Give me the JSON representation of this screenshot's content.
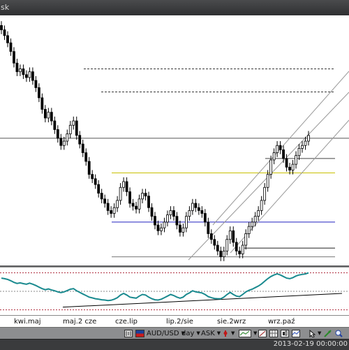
{
  "window": {
    "title": "sk"
  },
  "x_axis": {
    "labels": [
      {
        "id": "kwi",
        "text": "kwi.maj"
      },
      {
        "id": "maj",
        "text": "maj.2 cze"
      },
      {
        "id": "cze",
        "text": "cze.lip"
      },
      {
        "id": "lip",
        "text": "lip.2/sie"
      },
      {
        "id": "sie",
        "text": "sie.2wrz"
      },
      {
        "id": "wrz",
        "text": "wrz.paź"
      }
    ]
  },
  "toolbar": {
    "symbol": "AUD/USD",
    "period": "day",
    "price_side": "ASK"
  },
  "status": {
    "timestamp": "2013-02-19 00:00:00"
  },
  "colors": {
    "bull": "#ffffff",
    "bear": "#000000",
    "indicator": "#1a8a8f",
    "hline_blue": "#2020c0",
    "hline_yellow": "#c8c000",
    "band_red": "#b03040",
    "channel": "#999999"
  },
  "icons": [
    "chart-mode-icon",
    "dropdown-icon",
    "arrow-tool-icon",
    "period-tool-icon",
    "pointer-icon",
    "zoom-icon",
    "settings-icon"
  ],
  "chart_data": {
    "type": "candlestick",
    "instrument": "AUD/USD",
    "period": "day",
    "closes": [
      1.075,
      1.071,
      1.066,
      1.06,
      1.052,
      1.046,
      1.048,
      1.044,
      1.042,
      1.046,
      1.04,
      1.035,
      1.028,
      1.02,
      1.014,
      1.018,
      1.012,
      1.006,
      1.0,
      0.995,
      0.998,
      1.003,
      1.009,
      1.012,
      1.002,
      0.996,
      0.99,
      0.984,
      0.975,
      0.972,
      0.968,
      0.962,
      0.958,
      0.955,
      0.95,
      0.948,
      0.952,
      0.957,
      0.966,
      0.97,
      0.963,
      0.955,
      0.953,
      0.951,
      0.958,
      0.962,
      0.96,
      0.952,
      0.946,
      0.94,
      0.936,
      0.938,
      0.942,
      0.947,
      0.95,
      0.946,
      0.94,
      0.935,
      0.938,
      0.946,
      0.95,
      0.955,
      0.952,
      0.95,
      0.948,
      0.942,
      0.934,
      0.93,
      0.926,
      0.922,
      0.918,
      0.922,
      0.93,
      0.936,
      0.928,
      0.922,
      0.92,
      0.926,
      0.934,
      0.939,
      0.942,
      0.946,
      0.95,
      0.957,
      0.966,
      0.975,
      0.985,
      0.99,
      0.995,
      0.992,
      0.986,
      0.98,
      0.978,
      0.982,
      0.988,
      0.993,
      0.995,
      0.998,
      1.002
    ],
    "indicator": [
      0.5,
      0.48,
      0.45,
      0.4,
      0.34,
      0.3,
      0.32,
      0.29,
      0.27,
      0.31,
      0.27,
      0.22,
      0.16,
      0.1,
      0.06,
      0.09,
      0.05,
      0.02,
      -0.02,
      -0.05,
      -0.02,
      0.03,
      0.08,
      0.1,
      0.02,
      -0.04,
      -0.1,
      -0.16,
      -0.22,
      -0.25,
      -0.28,
      -0.3,
      -0.32,
      -0.33,
      -0.35,
      -0.34,
      -0.3,
      -0.24,
      -0.14,
      -0.08,
      -0.14,
      -0.22,
      -0.24,
      -0.26,
      -0.18,
      -0.12,
      -0.14,
      -0.22,
      -0.28,
      -0.32,
      -0.33,
      -0.3,
      -0.24,
      -0.18,
      -0.12,
      -0.16,
      -0.22,
      -0.26,
      -0.22,
      -0.12,
      -0.06,
      0.02,
      -0.02,
      -0.04,
      -0.06,
      -0.12,
      -0.2,
      -0.24,
      -0.27,
      -0.28,
      -0.28,
      -0.22,
      -0.12,
      -0.04,
      -0.12,
      -0.18,
      -0.2,
      -0.12,
      -0.02,
      0.04,
      0.08,
      0.14,
      0.2,
      0.28,
      0.38,
      0.48,
      0.56,
      0.62,
      0.66,
      0.62,
      0.56,
      0.5,
      0.48,
      0.52,
      0.58,
      0.62,
      0.64,
      0.66,
      0.7
    ],
    "horizontal_levels": [
      1.048,
      1.032,
      1.0,
      0.986,
      0.976,
      0.942,
      0.924
    ],
    "indicator_levels": [
      0.7,
      0.0,
      -0.7
    ]
  }
}
